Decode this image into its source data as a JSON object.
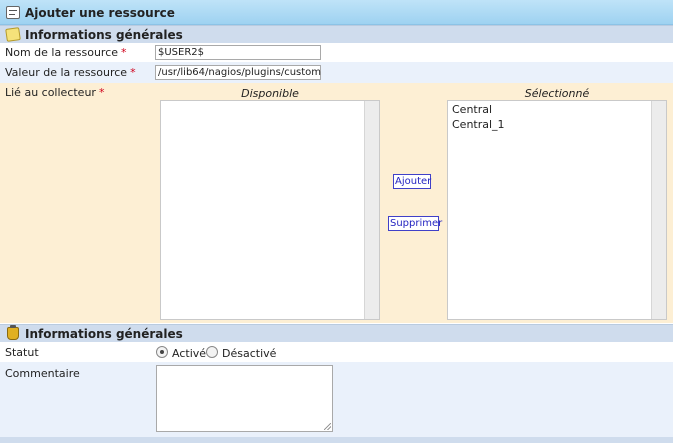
{
  "form": {
    "title": "Ajouter une ressource"
  },
  "sections": [
    {
      "title": "Informations générales"
    },
    {
      "title": "Informations générales"
    }
  ],
  "fields": {
    "name": {
      "label": "Nom de la ressource",
      "required": "*",
      "value": "$USER2$"
    },
    "value": {
      "label": "Valeur de la ressource",
      "required": "*",
      "value": "/usr/lib64/nagios/plugins/custom"
    },
    "collector": {
      "label": "Lié au collecteur",
      "required": "*",
      "available_header": "Disponible",
      "selected_header": "Sélectionné",
      "available": [],
      "selected": [
        "Central",
        "Central_1"
      ],
      "add_label": "Ajouter",
      "remove_label": "Supprimer"
    },
    "status": {
      "label": "Statut",
      "options": [
        {
          "label": "Activé",
          "checked": true
        },
        {
          "label": "Désactivé",
          "checked": false
        }
      ]
    },
    "comment": {
      "label": "Commentaire",
      "value": ""
    }
  },
  "icons": {
    "header": "form-icon",
    "section1": "note-icon",
    "section2": "pot-icon"
  }
}
